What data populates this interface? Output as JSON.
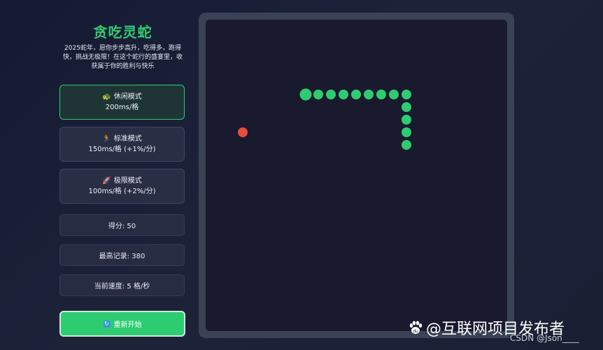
{
  "sidebar": {
    "title": "贪吃灵蛇",
    "description": "2025蛇年，愿你步步高升，吃得多，跑得快，挑战无极限！在这个蛇行的盛宴里，收获属于你的胜利与快乐",
    "modes": [
      {
        "icon": "🐢",
        "icon_name": "turtle-icon",
        "name": "休闲模式",
        "speed": "200ms/格",
        "active": true
      },
      {
        "icon": "🏃",
        "icon_name": "runner-icon",
        "name": "标准模式",
        "speed": "150ms/格 (+1%/分)",
        "active": false
      },
      {
        "icon": "🚀",
        "icon_name": "rocket-icon",
        "name": "极限模式",
        "speed": "100ms/格 (+2%/分)",
        "active": false
      }
    ],
    "stats": {
      "score": "得分: 50",
      "high_score": "最高记录: 380",
      "speed": "当前速度: 5 格/秒"
    },
    "restart_icon": "🔄",
    "restart_label": "重新开始"
  },
  "game": {
    "snake_color": "#2ecc71",
    "food_color": "#e74c3c",
    "board_color": "#191a2e",
    "snake": [
      {
        "col": 7,
        "row": 5
      },
      {
        "col": 8,
        "row": 5
      },
      {
        "col": 9,
        "row": 5
      },
      {
        "col": 10,
        "row": 5
      },
      {
        "col": 11,
        "row": 5
      },
      {
        "col": 12,
        "row": 5
      },
      {
        "col": 13,
        "row": 5
      },
      {
        "col": 14,
        "row": 5
      },
      {
        "col": 15,
        "row": 5
      },
      {
        "col": 15,
        "row": 6
      },
      {
        "col": 15,
        "row": 7
      },
      {
        "col": 15,
        "row": 8
      },
      {
        "col": 15,
        "row": 9
      }
    ],
    "food": {
      "col": 2,
      "row": 8
    }
  },
  "watermark": {
    "text": "@互联网项目发布者",
    "sub": "CSDN @Json____"
  },
  "colors": {
    "accent": "#2ecc71",
    "background": "#1c2238"
  }
}
